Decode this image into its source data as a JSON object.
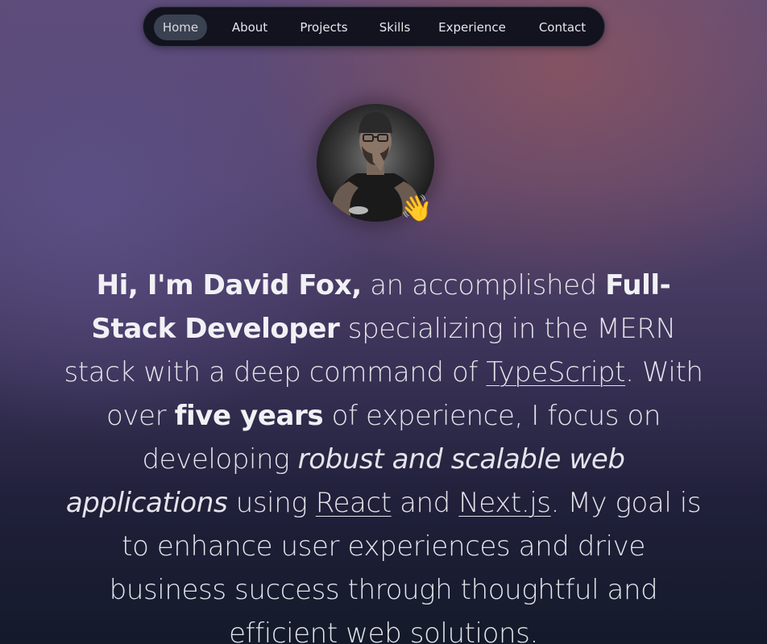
{
  "nav": {
    "items": [
      {
        "label": "Home",
        "active": true
      },
      {
        "label": "About"
      },
      {
        "label": "Projects"
      },
      {
        "label": "Skills"
      },
      {
        "label": "Experience"
      },
      {
        "label": "Contact"
      }
    ]
  },
  "hero": {
    "wave_emoji": "👋",
    "intro": {
      "name": "Hi, I'm David Fox,",
      "t1": " an accomplished ",
      "role": "Full-Stack Developer",
      "t2": " specializing in the MERN stack with a deep command of ",
      "link_typescript": "TypeScript",
      "t3": ". With over ",
      "years": "five years",
      "t4": " of experience, I focus on developing ",
      "emphasis": "robust and scalable web applications",
      "t5": " using ",
      "link_react": "React",
      "t6": " and ",
      "link_next": "Next.js",
      "t7": ". My goal is to enhance user experiences and drive business success through thoughtful and efficient web solutions."
    }
  },
  "colors": {
    "nav_bg": "#12131f",
    "nav_active_bg": "#3a4150",
    "text": "#e4e4ea"
  }
}
